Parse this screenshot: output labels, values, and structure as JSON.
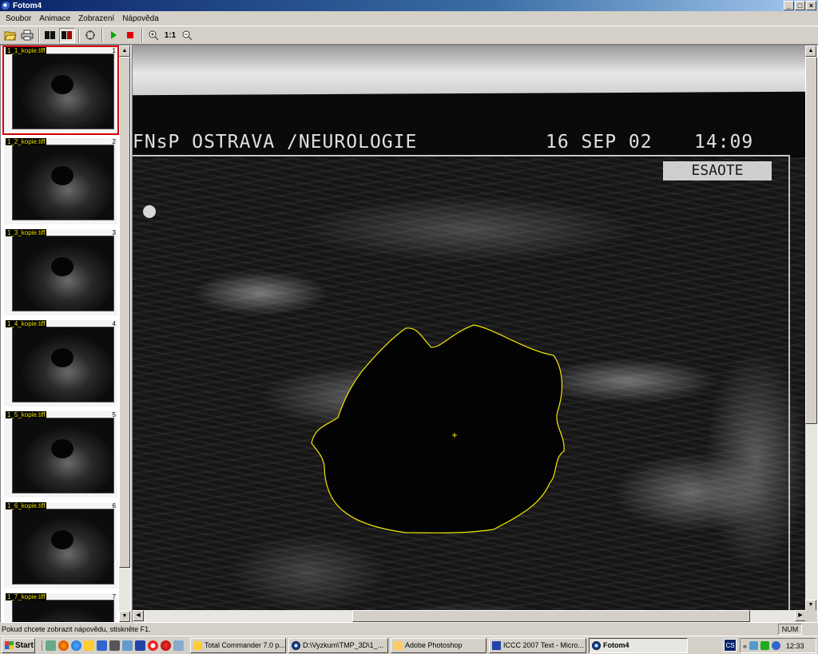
{
  "window": {
    "title": "Fotom4",
    "min": "_",
    "restore": "□",
    "close": "×"
  },
  "menu": [
    "Soubor",
    "Animace",
    "Zobrazení",
    "Nápověda"
  ],
  "toolbar": {
    "zoom_reset_label": "1:1"
  },
  "thumbnails": [
    {
      "label": "1_1_kopie.tiff",
      "number": "1"
    },
    {
      "label": "1_2_kopie.tiff",
      "number": "2"
    },
    {
      "label": "1_3_kopie.tiff",
      "number": "3"
    },
    {
      "label": "1_4_kopie.tiff",
      "number": "4"
    },
    {
      "label": "1_5_kopie.tiff",
      "number": "5"
    },
    {
      "label": "1_6_kopie.tiff",
      "number": "6"
    },
    {
      "label": "1_7_kopie.tiff",
      "number": "7"
    }
  ],
  "image": {
    "header_left": "FNsP OSTRAVA /NEUROLOGIE",
    "header_date": "16 SEP 02",
    "header_time": "14:09",
    "brand": "ESAOTE",
    "contour_color": "#f2e600"
  },
  "status": {
    "hint": "Pokud chcete zobrazit nápovědu, stiskněte F1.",
    "num": "NUM"
  },
  "taskbar": {
    "start": "Start",
    "tasks": [
      "Total Commander 7.0 p...",
      "D:\\Vyzkum\\TMP_3D\\1_...",
      "Adobe Photoshop",
      "ICCC 2007 Text - Micro...",
      "Fotom4"
    ],
    "lang": "CS",
    "clock": "12:33"
  }
}
